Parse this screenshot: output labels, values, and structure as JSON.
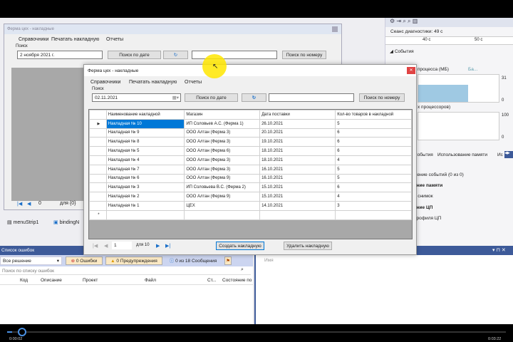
{
  "back_form": {
    "title": "Ферма цех - накладные",
    "menu": [
      "Справочники",
      "Печатать накладную",
      "Отчеты"
    ],
    "search_label": "Поиск",
    "date_value": "2  ноября  2021 г.",
    "search_date": "Поиск по дате",
    "search_number": "Поиск по номеру",
    "nav_pos": "0",
    "nav_count": "для {0}"
  },
  "tray": [
    "menuStrip1",
    "bindingN"
  ],
  "form": {
    "title": "Ферма цех - накладные",
    "menu": [
      "Справочники",
      "Печатать накладную",
      "Отчеты"
    ],
    "search_label": "Поиск",
    "date_value": "02.11.2021",
    "search_date": "Поиск по дате",
    "search_number_value": "",
    "search_number": "Поиск по номеру",
    "columns": [
      "Наименование накладной",
      "Магазин",
      "Дата поставки",
      "Кол-во товаров в накладной"
    ],
    "rows": [
      [
        "Накладная № 10",
        "ИП Соловьев А.С. (Ферма 1)",
        "26.10.2021",
        "5"
      ],
      [
        "Накладная № 9",
        "ООО Алтан (Ферма 3)",
        "20.10.2021",
        "6"
      ],
      [
        "Накладная № 8",
        "ООО Алтан (Ферма 3)",
        "19.10.2021",
        "6"
      ],
      [
        "Накладная № 5",
        "ООО Алтан (Ферма 6)",
        "18.10.2021",
        "6"
      ],
      [
        "Накладная № 4",
        "ООО Алтан (Ферма 3)",
        "18.10.2021",
        "4"
      ],
      [
        "Накладная № 7",
        "ООО Алтан (Ферма 3)",
        "16.10.2021",
        "5"
      ],
      [
        "Накладная № 6",
        "ООО Алтан (Ферма 9)",
        "16.10.2021",
        "5"
      ],
      [
        "Накладная № 3",
        "ИП Соловьева В.С. (Ферма 2)",
        "15.10.2021",
        "6"
      ],
      [
        "Накладная № 2",
        "ООО Алтан (Ферма 9)",
        "15.10.2021",
        "4"
      ],
      [
        "Накладная № 1",
        "ЦЕХ",
        "14.10.2021",
        "3"
      ]
    ],
    "nav_pos": "1",
    "nav_count": "для 10",
    "create": "Создать накладную",
    "delete": "Удалить накладную"
  },
  "diag": {
    "session": "Сеанс диагностики: 49 с",
    "t1": "40 с",
    "t2": "50 с",
    "events": "События",
    "memory": "процесса (МБ)",
    "mem_legend": "Ба...",
    "mem_max": "31",
    "mem_min": "0",
    "cpu": "х процессоров)",
    "cpu_max": "100",
    "cpu_min": "0",
    "tabs": [
      "События",
      "Использование памяти",
      "Ис"
    ],
    "items": [
      "жение событий (0 из 0)",
      "ание памяти",
      "ь снимок",
      "ание ЦП",
      "профиля ЦП"
    ]
  },
  "errors": {
    "title": "Список ошибок",
    "scope": "Все решение",
    "err": "0 Ошибки",
    "warn": "0 Предупреждения",
    "msg": "0 из 18 Сообщения",
    "search": "Поиск по списку ошибок",
    "cols": [
      "Код",
      "Описание",
      "Проект",
      "Файл",
      "Ст...",
      "Состояние по"
    ]
  },
  "right_bottom": {
    "label": "Имя"
  },
  "video": {
    "current": "0:00:02",
    "total": "0:03:22",
    "progress": 0.01
  }
}
